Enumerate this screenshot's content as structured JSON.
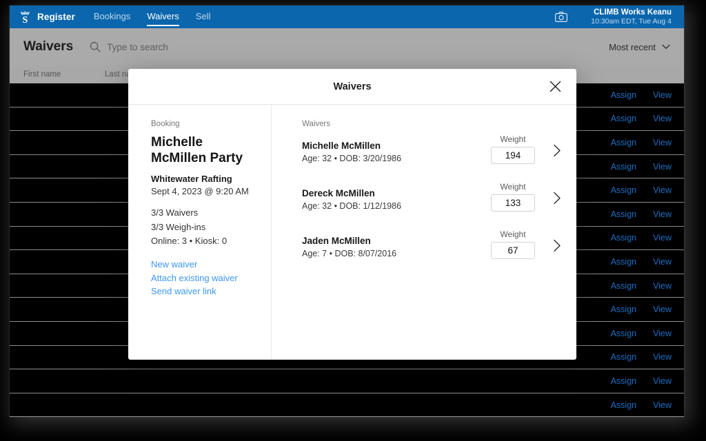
{
  "topnav": {
    "logo_icon": "crown-s-logo",
    "brand": "Register",
    "items": [
      {
        "label": "Bookings",
        "active": false
      },
      {
        "label": "Waivers",
        "active": true
      },
      {
        "label": "Sell",
        "active": false
      }
    ],
    "camera_icon": "camera-icon",
    "account": {
      "name": "CLIMB Works Keanu",
      "time": "10:30am EDT, Tue Aug 4"
    },
    "bg_color": "#0b66ad"
  },
  "page_header": {
    "title": "Waivers",
    "search_icon": "search-icon",
    "search_placeholder": "Type to search",
    "sort_label": "Most recent",
    "sort_icon": "chevron-down-icon"
  },
  "table": {
    "columns": [
      "First name",
      "Last name"
    ],
    "row_actions": {
      "assign": "Assign",
      "view": "View"
    },
    "row_count": 14,
    "link_color": "#1b6fc4"
  },
  "modal": {
    "title": "Waivers",
    "close_icon": "close-icon",
    "booking": {
      "section_label": "Booking",
      "name": "Michelle McMillen Party",
      "activity": "Whitewater Rafting",
      "datetime": "Sept 4, 2023 @ 9:20 AM",
      "stats": [
        "3/3 Waivers",
        "3/3 Weigh-ins",
        "Online: 3 • Kiosk: 0"
      ],
      "actions": [
        "New waiver",
        "Attach existing waiver",
        "Send waiver link"
      ],
      "action_color": "#3b97f3"
    },
    "waivers": {
      "section_label": "Waivers",
      "weight_label": "Weight",
      "chevron_icon": "chevron-right-icon",
      "entries": [
        {
          "name": "Michelle McMillen",
          "meta": "Age: 32 • DOB: 3/20/1986",
          "weight": "194"
        },
        {
          "name": "Dereck McMillen",
          "meta": "Age: 32 • DOB: 1/12/1986",
          "weight": "133"
        },
        {
          "name": "Jaden McMillen",
          "meta": "Age: 7 • DOB: 8/07/2016",
          "weight": "67"
        }
      ]
    }
  }
}
